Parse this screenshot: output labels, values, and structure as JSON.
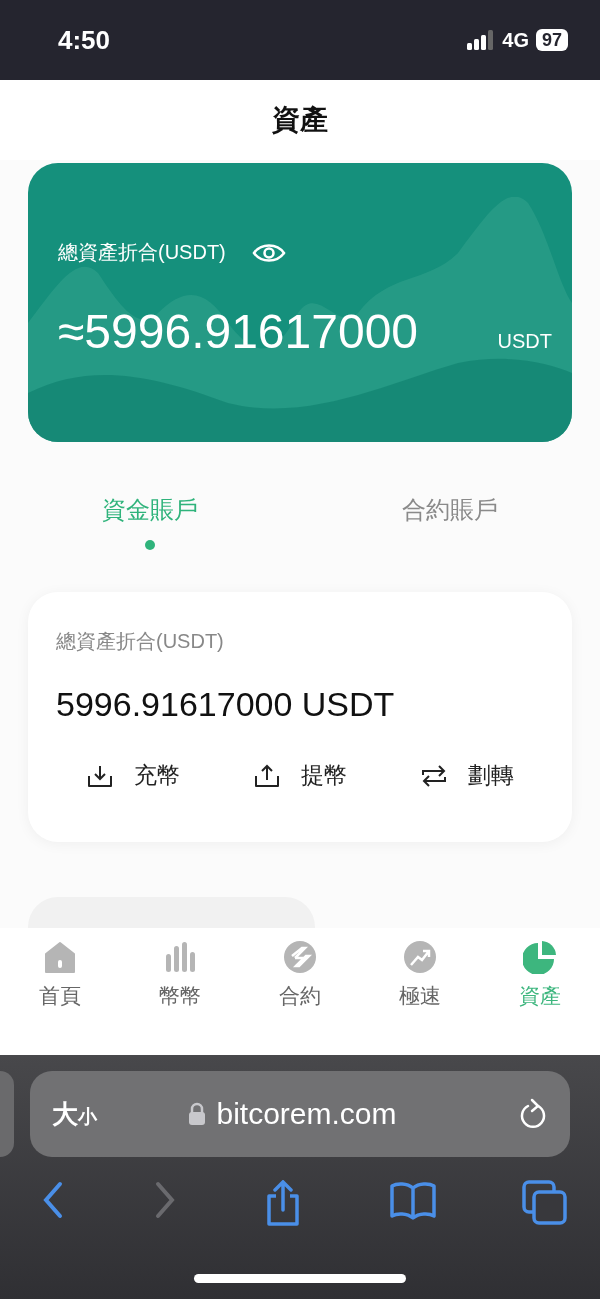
{
  "status_bar": {
    "time": "4:50",
    "network": "4G",
    "battery": "97"
  },
  "page_title": "資產",
  "summary_card": {
    "label": "總資產折合(USDT)",
    "amount": "≈5996.91617000",
    "unit": "USDT"
  },
  "account_tabs": [
    {
      "label": "資金賬戶",
      "selected": true
    },
    {
      "label": "合約賬戶",
      "selected": false
    }
  ],
  "account_card": {
    "label": "總資產折合(USDT)",
    "amount": "5996.91617000 USDT",
    "actions": [
      {
        "kind": "deposit",
        "label": "充幣"
      },
      {
        "kind": "withdraw",
        "label": "提幣"
      },
      {
        "kind": "transfer",
        "label": "劃轉"
      }
    ]
  },
  "bottom_nav": [
    {
      "kind": "home",
      "label": "首頁",
      "selected": false
    },
    {
      "kind": "bars",
      "label": "幣幣",
      "selected": false
    },
    {
      "kind": "contract",
      "label": "合約",
      "selected": false
    },
    {
      "kind": "speed",
      "label": "極速",
      "selected": false
    },
    {
      "kind": "pie",
      "label": "資產",
      "selected": true
    }
  ],
  "browser": {
    "text_size_big": "大",
    "text_size_small": "小",
    "url": "bitcorem.com"
  }
}
